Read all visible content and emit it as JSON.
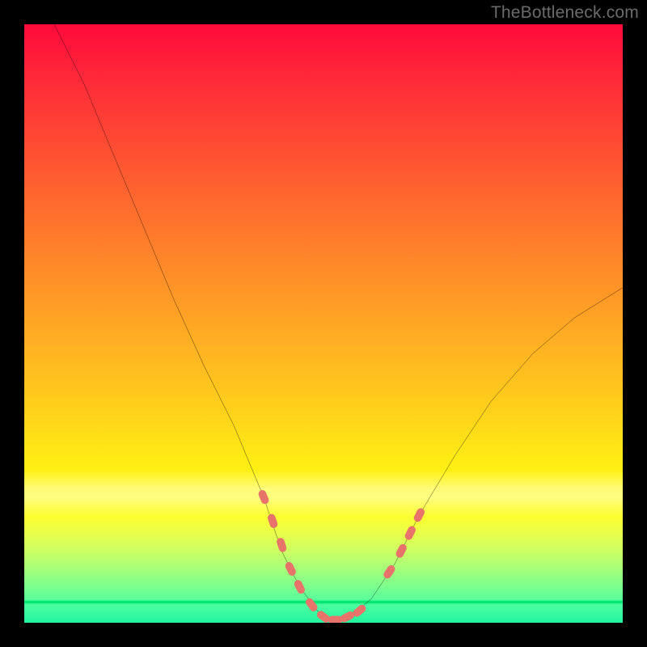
{
  "watermark": "TheBottleneck.com",
  "chart_data": {
    "type": "line",
    "title": "",
    "xlabel": "",
    "ylabel": "",
    "xlim": [
      0,
      100
    ],
    "ylim": [
      0,
      100
    ],
    "grid": false,
    "legend": false,
    "curve": {
      "x": [
        5,
        10,
        15,
        20,
        25,
        30,
        35,
        40,
        43,
        46,
        49,
        51,
        53,
        55,
        58,
        62,
        66,
        72,
        78,
        85,
        92,
        100
      ],
      "y": [
        100,
        90,
        78,
        66,
        54,
        43,
        33,
        21,
        12,
        6,
        2,
        0.5,
        0.5,
        1.5,
        4,
        10,
        18,
        28,
        37,
        45,
        51,
        56
      ]
    },
    "markers": {
      "comment": "pink capsule-shaped highlight segments along the curve",
      "segments": [
        {
          "x": 40.0,
          "y": 21.0
        },
        {
          "x": 41.5,
          "y": 17.0
        },
        {
          "x": 43.0,
          "y": 13.0
        },
        {
          "x": 44.5,
          "y": 9.0
        },
        {
          "x": 46.0,
          "y": 6.0
        },
        {
          "x": 48.0,
          "y": 3.0
        },
        {
          "x": 50.0,
          "y": 1.0
        },
        {
          "x": 52.0,
          "y": 0.5
        },
        {
          "x": 54.0,
          "y": 1.0
        },
        {
          "x": 56.0,
          "y": 2.0
        },
        {
          "x": 61.0,
          "y": 8.5
        },
        {
          "x": 63.0,
          "y": 12.0
        },
        {
          "x": 64.5,
          "y": 15.0
        },
        {
          "x": 66.0,
          "y": 18.0
        }
      ],
      "color": "#e8736b"
    },
    "background_gradient": {
      "top": "#ff0a3a",
      "mid": "#ffd21a",
      "bottom": "#23f4a0"
    }
  }
}
